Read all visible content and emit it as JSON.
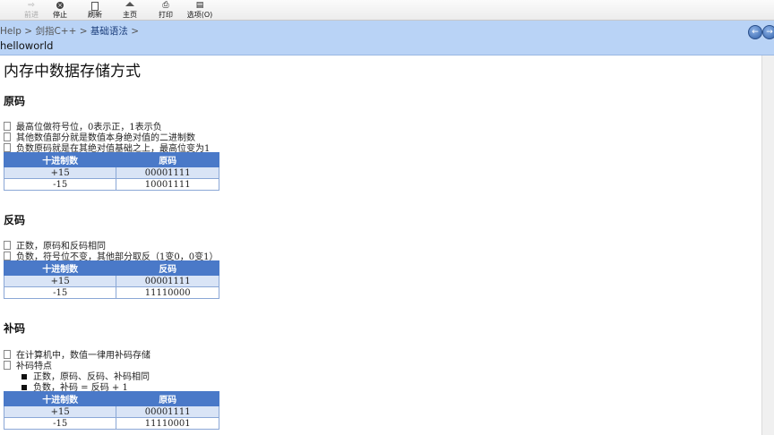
{
  "toolbar": {
    "buttons": [
      {
        "label": "前进",
        "icon": "forward-arrow-icon",
        "disabled": true
      },
      {
        "label": "停止",
        "icon": "stop-icon"
      },
      {
        "label": "刷新",
        "icon": "refresh-icon"
      },
      {
        "label": "主页",
        "icon": "home-icon"
      },
      {
        "label": "打印",
        "icon": "print-icon"
      },
      {
        "label": "选项(O)",
        "icon": "options-icon"
      }
    ]
  },
  "breadcrumb": {
    "items": [
      "Help",
      "剑指C++",
      "基础语法"
    ],
    "separator": ">",
    "topic": "helloworld"
  },
  "nav": {
    "back_glyph": "←",
    "forward_glyph": "→"
  },
  "page": {
    "title": "内存中数据存储方式",
    "sections": [
      {
        "heading": "原码",
        "bullets": [
          "最高位做符号位，0表示正，1表示负",
          "其他数值部分就是数值本身绝对值的二进制数",
          "负数原码就是在其绝对值基础之上，最高位变为1"
        ],
        "table": {
          "headers": [
            "十进制数",
            "原码"
          ],
          "rows": [
            [
              "+15",
              "00001111"
            ],
            [
              "-15",
              "10001111"
            ]
          ]
        }
      },
      {
        "heading": "反码",
        "bullets": [
          "正数，原码和反码相同",
          "负数，符号位不变，其他部分取反（1变0，0变1）"
        ],
        "table": {
          "headers": [
            "十进制数",
            "反码"
          ],
          "rows": [
            [
              "+15",
              "00001111"
            ],
            [
              "-15",
              "11110000"
            ]
          ]
        }
      },
      {
        "heading": "补码",
        "bullets": [
          "在计算机中，数值一律用补码存储",
          "补码特点"
        ],
        "sub_bullets": [
          "正数，原码、反码、补码相同",
          "负数，补码 = 反码 + 1"
        ],
        "table": {
          "headers": [
            "十进制数",
            "原码"
          ],
          "rows": [
            [
              "+15",
              "00001111"
            ],
            [
              "-15",
              "11110001"
            ]
          ]
        }
      }
    ]
  },
  "colors": {
    "header_bar": "#b9d3f6",
    "table_header": "#4a79c8",
    "table_row_alt": "#d9e4f6"
  }
}
